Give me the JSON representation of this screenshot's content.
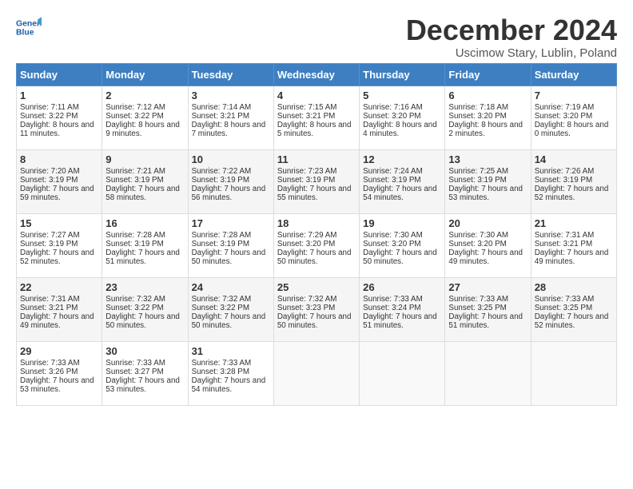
{
  "logo": {
    "line1": "General",
    "line2": "Blue"
  },
  "title": "December 2024",
  "subtitle": "Uscimow Stary, Lublin, Poland",
  "days_of_week": [
    "Sunday",
    "Monday",
    "Tuesday",
    "Wednesday",
    "Thursday",
    "Friday",
    "Saturday"
  ],
  "weeks": [
    [
      {
        "day": 1,
        "sunrise": "7:11 AM",
        "sunset": "3:22 PM",
        "daylight": "8 hours and 11 minutes."
      },
      {
        "day": 2,
        "sunrise": "7:12 AM",
        "sunset": "3:22 PM",
        "daylight": "8 hours and 9 minutes."
      },
      {
        "day": 3,
        "sunrise": "7:14 AM",
        "sunset": "3:21 PM",
        "daylight": "8 hours and 7 minutes."
      },
      {
        "day": 4,
        "sunrise": "7:15 AM",
        "sunset": "3:21 PM",
        "daylight": "8 hours and 5 minutes."
      },
      {
        "day": 5,
        "sunrise": "7:16 AM",
        "sunset": "3:20 PM",
        "daylight": "8 hours and 4 minutes."
      },
      {
        "day": 6,
        "sunrise": "7:18 AM",
        "sunset": "3:20 PM",
        "daylight": "8 hours and 2 minutes."
      },
      {
        "day": 7,
        "sunrise": "7:19 AM",
        "sunset": "3:20 PM",
        "daylight": "8 hours and 0 minutes."
      }
    ],
    [
      {
        "day": 8,
        "sunrise": "7:20 AM",
        "sunset": "3:19 PM",
        "daylight": "7 hours and 59 minutes."
      },
      {
        "day": 9,
        "sunrise": "7:21 AM",
        "sunset": "3:19 PM",
        "daylight": "7 hours and 58 minutes."
      },
      {
        "day": 10,
        "sunrise": "7:22 AM",
        "sunset": "3:19 PM",
        "daylight": "7 hours and 56 minutes."
      },
      {
        "day": 11,
        "sunrise": "7:23 AM",
        "sunset": "3:19 PM",
        "daylight": "7 hours and 55 minutes."
      },
      {
        "day": 12,
        "sunrise": "7:24 AM",
        "sunset": "3:19 PM",
        "daylight": "7 hours and 54 minutes."
      },
      {
        "day": 13,
        "sunrise": "7:25 AM",
        "sunset": "3:19 PM",
        "daylight": "7 hours and 53 minutes."
      },
      {
        "day": 14,
        "sunrise": "7:26 AM",
        "sunset": "3:19 PM",
        "daylight": "7 hours and 52 minutes."
      }
    ],
    [
      {
        "day": 15,
        "sunrise": "7:27 AM",
        "sunset": "3:19 PM",
        "daylight": "7 hours and 52 minutes."
      },
      {
        "day": 16,
        "sunrise": "7:28 AM",
        "sunset": "3:19 PM",
        "daylight": "7 hours and 51 minutes."
      },
      {
        "day": 17,
        "sunrise": "7:28 AM",
        "sunset": "3:19 PM",
        "daylight": "7 hours and 50 minutes."
      },
      {
        "day": 18,
        "sunrise": "7:29 AM",
        "sunset": "3:20 PM",
        "daylight": "7 hours and 50 minutes."
      },
      {
        "day": 19,
        "sunrise": "7:30 AM",
        "sunset": "3:20 PM",
        "daylight": "7 hours and 50 minutes."
      },
      {
        "day": 20,
        "sunrise": "7:30 AM",
        "sunset": "3:20 PM",
        "daylight": "7 hours and 49 minutes."
      },
      {
        "day": 21,
        "sunrise": "7:31 AM",
        "sunset": "3:21 PM",
        "daylight": "7 hours and 49 minutes."
      }
    ],
    [
      {
        "day": 22,
        "sunrise": "7:31 AM",
        "sunset": "3:21 PM",
        "daylight": "7 hours and 49 minutes."
      },
      {
        "day": 23,
        "sunrise": "7:32 AM",
        "sunset": "3:22 PM",
        "daylight": "7 hours and 50 minutes."
      },
      {
        "day": 24,
        "sunrise": "7:32 AM",
        "sunset": "3:22 PM",
        "daylight": "7 hours and 50 minutes."
      },
      {
        "day": 25,
        "sunrise": "7:32 AM",
        "sunset": "3:23 PM",
        "daylight": "7 hours and 50 minutes."
      },
      {
        "day": 26,
        "sunrise": "7:33 AM",
        "sunset": "3:24 PM",
        "daylight": "7 hours and 51 minutes."
      },
      {
        "day": 27,
        "sunrise": "7:33 AM",
        "sunset": "3:25 PM",
        "daylight": "7 hours and 51 minutes."
      },
      {
        "day": 28,
        "sunrise": "7:33 AM",
        "sunset": "3:25 PM",
        "daylight": "7 hours and 52 minutes."
      }
    ],
    [
      {
        "day": 29,
        "sunrise": "7:33 AM",
        "sunset": "3:26 PM",
        "daylight": "7 hours and 53 minutes."
      },
      {
        "day": 30,
        "sunrise": "7:33 AM",
        "sunset": "3:27 PM",
        "daylight": "7 hours and 53 minutes."
      },
      {
        "day": 31,
        "sunrise": "7:33 AM",
        "sunset": "3:28 PM",
        "daylight": "7 hours and 54 minutes."
      },
      null,
      null,
      null,
      null
    ]
  ]
}
